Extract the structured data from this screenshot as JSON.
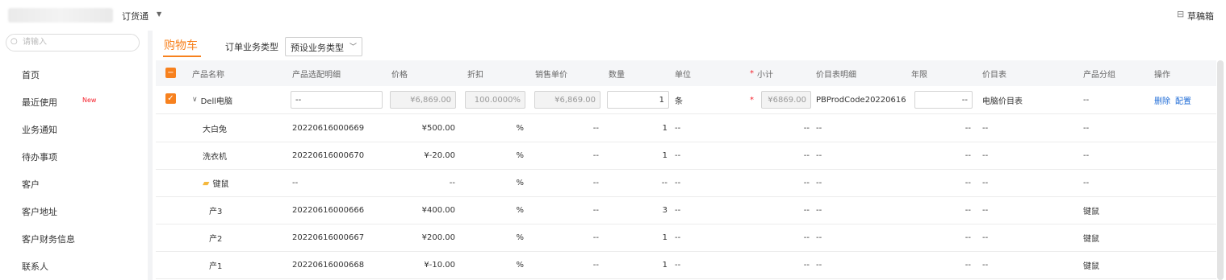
{
  "topbar": {
    "app_name": "订货通",
    "draft_label": "草稿箱",
    "draft_icon": "inbox-icon",
    "caret_icon": "caret-down-icon"
  },
  "sidebar": {
    "search_placeholder": "请输入",
    "items": [
      {
        "label": "首页"
      },
      {
        "label": "最近使用",
        "badge": "New"
      },
      {
        "label": "业务通知"
      },
      {
        "label": "待办事项"
      },
      {
        "label": "客户"
      },
      {
        "label": "客户地址"
      },
      {
        "label": "客户财务信息"
      },
      {
        "label": "联系人"
      }
    ]
  },
  "cart": {
    "tab_label": "购物车",
    "order_type_label": "订单业务类型",
    "order_type_value": "预设业务类型",
    "accent": "#f7811e"
  },
  "table": {
    "headers": {
      "name": "产品名称",
      "config": "产品选配明细",
      "price": "价格",
      "discount": "折扣",
      "sale_price": "销售单价",
      "qty": "数量",
      "unit": "单位",
      "subtotal": "小计",
      "pricebook_detail": "价目表明细",
      "term": "年限",
      "pricebook": "价目表",
      "group": "产品分组",
      "actions": "操作"
    },
    "main_row": {
      "name": "Dell电脑",
      "config": "--",
      "price": "¥6,869.00",
      "discount": "100.0000%",
      "sale_price": "¥6,869.00",
      "qty": "1",
      "unit": "条",
      "subtotal": "¥6869.00",
      "pricebook_detail": "PBProdCode20220616...",
      "term": "--",
      "pricebook": "电脑价目表",
      "group": "--",
      "delete": "删除",
      "configure": "配置"
    },
    "rows": [
      {
        "name": "大白兔",
        "config": "20220616000669",
        "price": "¥500.00",
        "discount": "%",
        "sale_price": "--",
        "qty": "1",
        "unit": "--",
        "subtotal": "--",
        "pricebook_detail": "--",
        "term": "--",
        "pricebook": "--",
        "group": "--"
      },
      {
        "name": "洗衣机",
        "config": "20220616000670",
        "price": "¥-20.00",
        "discount": "%",
        "sale_price": "--",
        "qty": "1",
        "unit": "--",
        "subtotal": "--",
        "pricebook_detail": "--",
        "term": "--",
        "pricebook": "--",
        "group": "--"
      },
      {
        "name": "键鼠",
        "config": "--",
        "price": "--",
        "discount": "%",
        "sale_price": "--",
        "qty": "--",
        "unit": "--",
        "subtotal": "--",
        "pricebook_detail": "--",
        "term": "--",
        "pricebook": "--",
        "group": "--"
      },
      {
        "name": "产3",
        "config": "20220616000666",
        "price": "¥400.00",
        "discount": "%",
        "sale_price": "--",
        "qty": "3",
        "unit": "--",
        "subtotal": "--",
        "pricebook_detail": "--",
        "term": "--",
        "pricebook": "--",
        "group": "键鼠"
      },
      {
        "name": "产2",
        "config": "20220616000667",
        "price": "¥200.00",
        "discount": "%",
        "sale_price": "--",
        "qty": "1",
        "unit": "--",
        "subtotal": "--",
        "pricebook_detail": "--",
        "term": "--",
        "pricebook": "--",
        "group": "键鼠"
      },
      {
        "name": "产1",
        "config": "20220616000668",
        "price": "¥-10.00",
        "discount": "%",
        "sale_price": "--",
        "qty": "1",
        "unit": "--",
        "subtotal": "--",
        "pricebook_detail": "--",
        "term": "--",
        "pricebook": "--",
        "group": "键鼠"
      }
    ]
  }
}
